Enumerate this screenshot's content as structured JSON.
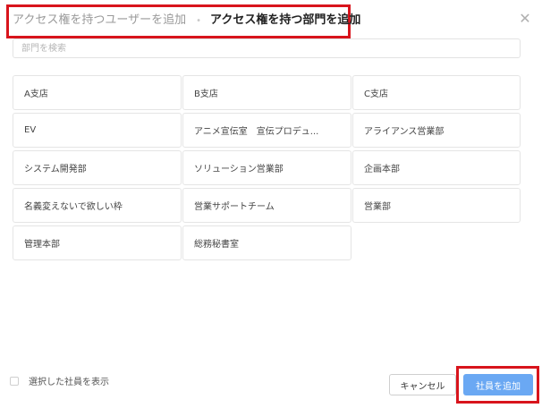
{
  "header": {
    "tabs": [
      {
        "label": "アクセス権を持つユーザーを追加",
        "active": false
      },
      {
        "label": "アクセス権を持つ部門を追加",
        "active": true
      }
    ],
    "separator": "•",
    "close_glyph": "✕"
  },
  "search": {
    "placeholder": "部門を検索",
    "value": ""
  },
  "departments": [
    "A支店",
    "B支店",
    "C支店",
    "EV",
    "アニメ宣伝室　宣伝プロデュ...",
    "アライアンス営業部",
    "システム開発部",
    "ソリューション営業部",
    "企画本部",
    "名義変えないで欲しい枠",
    "営業サポートチーム",
    "営業部",
    "管理本部",
    "総務秘書室"
  ],
  "footer": {
    "show_selected_label": "選択した社員を表示",
    "show_selected_checked": false,
    "cancel_label": "キャンセル",
    "add_label": "社員を追加"
  },
  "colors": {
    "accent": "#6aa8f3",
    "highlight": "#d8141c"
  }
}
